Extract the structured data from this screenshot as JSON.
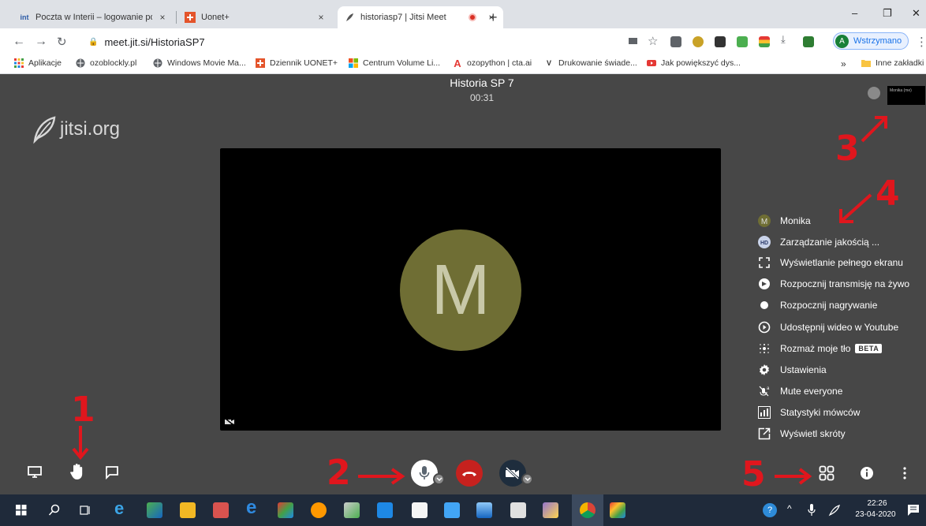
{
  "browser": {
    "tabs": [
      {
        "favicon": "int",
        "title": "Poczta w Interii – logowanie pocz",
        "close": "×"
      },
      {
        "favicon": "uonet-icon",
        "title": "Uonet+",
        "close": "×"
      },
      {
        "favicon": "jitsi-feather-icon",
        "title": "historiasp7 | Jitsi Meet",
        "close": "×"
      }
    ],
    "new_tab": "+",
    "window_controls": {
      "minimize": "–",
      "restore": "❐",
      "close": "✕"
    },
    "url": "meet.jit.si/HistoriaSP7",
    "profile": {
      "initial": "A",
      "label": "Wstrzymano"
    },
    "bookmarks": [
      {
        "icon": "apps-grid-icon",
        "label": "Aplikacje"
      },
      {
        "icon": "globe-icon",
        "label": "ozoblockly.pl"
      },
      {
        "icon": "globe-icon",
        "label": "Windows Movie Ma..."
      },
      {
        "icon": "uonet-icon",
        "label": "Dziennik UONET+"
      },
      {
        "icon": "windows-icon",
        "label": "Centrum Volume Li..."
      },
      {
        "icon": "a-logo-icon",
        "label": "ozopython | cta.ai"
      },
      {
        "icon": "v-logo-icon",
        "label": "Drukowanie świade..."
      },
      {
        "icon": "youtube-icon",
        "label": "Jak powiększyć dys..."
      }
    ],
    "more_bookmarks": "»",
    "other_bookmarks": "Inne zakładki"
  },
  "meeting": {
    "logo_text": "jitsi.org",
    "title": "Historia SP 7",
    "timer": "00:31",
    "avatar_initial": "M",
    "avatar_color": "#6f6e34",
    "thumbnail_label": "Monika (me)"
  },
  "annotations": [
    "1",
    "2",
    "3",
    "4",
    "5"
  ],
  "menu": {
    "items": [
      {
        "icon": "avatar-m-icon",
        "label": "Monika"
      },
      {
        "icon": "hd-icon",
        "label": "Zarządzanie jakością ..."
      },
      {
        "icon": "fullscreen-icon",
        "label": "Wyświetlanie pełnego ekranu"
      },
      {
        "icon": "live-stream-icon",
        "label": "Rozpocznij transmisję na żywo"
      },
      {
        "icon": "record-icon",
        "label": "Rozpocznij nagrywanie"
      },
      {
        "icon": "play-circle-icon",
        "label": "Udostępnij wideo w Youtube"
      },
      {
        "icon": "blur-icon",
        "label": "Rozmaż moje tło",
        "badge": "BETA"
      },
      {
        "icon": "gear-icon",
        "label": "Ustawienia"
      },
      {
        "icon": "mute-everyone-icon",
        "label": "Mute everyone"
      },
      {
        "icon": "bar-chart-icon",
        "label": "Statystyki mówców"
      },
      {
        "icon": "external-link-icon",
        "label": "Wyświetl skróty"
      }
    ]
  },
  "taskbar": {
    "time": "22:26",
    "date": "23-04-2020"
  },
  "colors": {
    "stage_bg": "#474747",
    "hangup": "#c6211e",
    "annotation": "#e0161d",
    "taskbar": "#1f2a3a"
  }
}
